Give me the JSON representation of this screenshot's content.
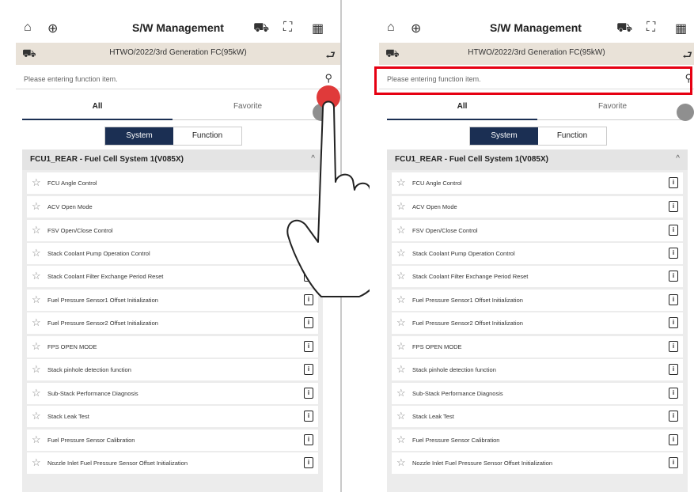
{
  "title": "S/W Management",
  "vehicle": "HTWO/2022/3rd Generation FC(95kW)",
  "search_placeholder": "Please entering function item.",
  "tabs": [
    "All",
    "Favorite"
  ],
  "segments": [
    "System",
    "Function"
  ],
  "section_title": "FCU1_REAR - Fuel Cell System 1(V085X)",
  "items": [
    "FCU Angle Control",
    "ACV Open Mode",
    "FSV Open/Close Control",
    "Stack Coolant Pump Operation Control",
    "Stack Coolant Filter Exchange Period Reset",
    "Fuel Pressure Sensor1 Offset Initialization",
    "Fuel Pressure Sensor2 Offset Initialization",
    "FPS OPEN MODE",
    "Stack pinhole detection function",
    "Sub-Stack Performance Diagnosis",
    "Stack Leak Test",
    "Fuel Pressure Sensor Calibration",
    "Nozzle Inlet Fuel Pressure Sensor Offset Initialization"
  ],
  "icons": {
    "home": "⌂",
    "globe": "⊕",
    "car": "⛟",
    "expand": "⛶",
    "grid": "▦",
    "back": "⮐",
    "search": "⚲",
    "star": "☆",
    "info": "i",
    "caret": "^"
  },
  "colors": {
    "navy": "#1b2f53",
    "highlight": "#e60012",
    "vehicle_bar": "#e9e2d8"
  }
}
